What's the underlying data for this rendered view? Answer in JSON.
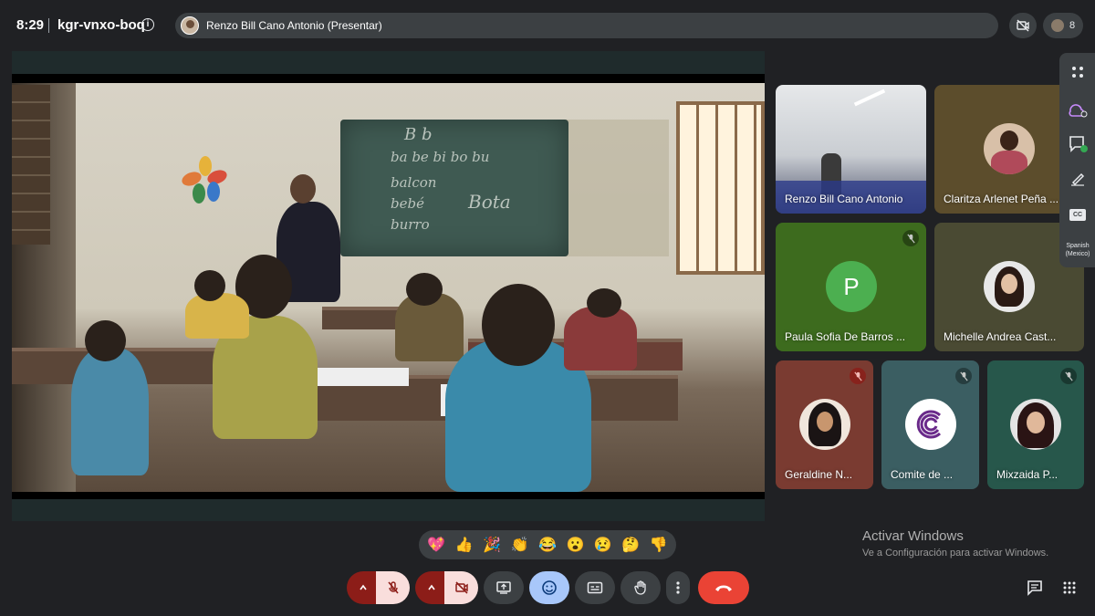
{
  "header": {
    "time": "8:29",
    "meeting_code": "kgr-vnxo-boq",
    "presenter_label": "Renzo Bill Cano Antonio (Presentar)",
    "participant_count": "8"
  },
  "participants": [
    {
      "name": "Renzo Bill Cano Antonio",
      "type": "video",
      "muted": false
    },
    {
      "name": "Claritza Arlenet Peña ...",
      "type": "photo",
      "muted": false
    },
    {
      "name": "Paula Sofia De Barros ...",
      "type": "letter",
      "initial": "P",
      "muted": true
    },
    {
      "name": "Michelle Andrea Cast...",
      "type": "photo",
      "muted": false
    },
    {
      "name": "Geraldine N...",
      "type": "photo",
      "muted": true
    },
    {
      "name": "Comite de ...",
      "type": "logo",
      "muted": true
    },
    {
      "name": "Mixzaida P...",
      "type": "photo",
      "muted": true
    }
  ],
  "side_panel": {
    "icons": [
      "apps-icon",
      "weather-icon",
      "chat-bubble-icon",
      "pen-icon",
      "captions-icon"
    ],
    "caption_badge": "CC",
    "language": "Spanish (Mexico)"
  },
  "presentation": {
    "chalk_lines": [
      "B b",
      "ba be bi bo bu",
      "balcon",
      "bebé",
      "burro",
      "Bota"
    ]
  },
  "reactions": [
    "💖",
    "👍",
    "🎉",
    "👏",
    "😂",
    "😮",
    "😢",
    "🤔",
    "👎"
  ],
  "watermark": {
    "title": "Activar Windows",
    "subtitle": "Ve a Configuración para activar Windows."
  },
  "colors": {
    "background": "#202124",
    "control_dark": "#3c4043",
    "danger": "#ea4335",
    "muted_red": "#8c1d18",
    "muted_pink": "#f9dedc",
    "accent_blue": "#a8c7fa"
  }
}
